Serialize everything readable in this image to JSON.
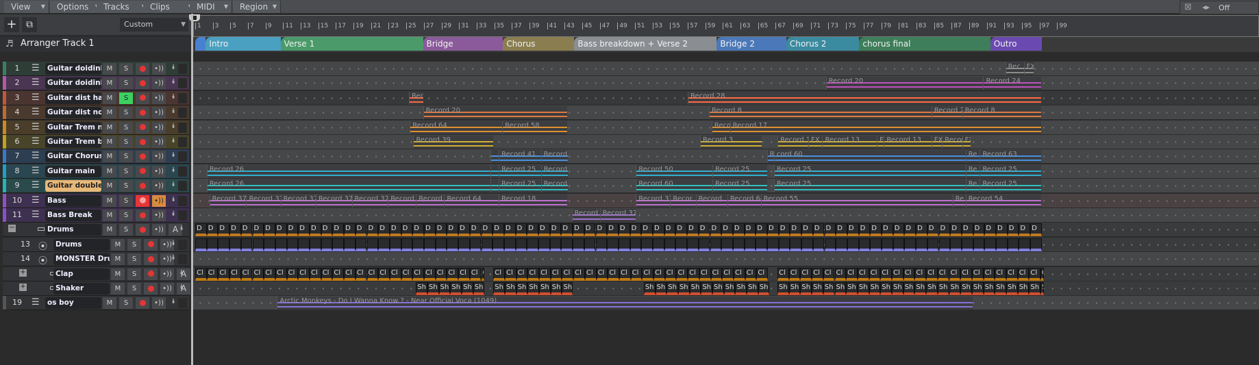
{
  "menubar": [
    {
      "label": "View"
    },
    {
      "label": "Options"
    },
    {
      "label": "Tracks"
    },
    {
      "label": "Clips"
    },
    {
      "label": "MIDI"
    },
    {
      "label": "Region FX"
    }
  ],
  "toolbar": {
    "add_icon": "plus-icon",
    "duplicate_icon": "duplicate-icon",
    "preset": "Custom"
  },
  "topright": {
    "snap_label": "Off",
    "icons": [
      "mixer-icon",
      "snap-icon"
    ]
  },
  "ruler": {
    "ticks": [
      "1",
      "3",
      "5",
      "7",
      "9",
      "11",
      "13",
      "15",
      "17",
      "19",
      "21",
      "23",
      "25",
      "27",
      "29",
      "31",
      "33",
      "35",
      "37",
      "39",
      "41",
      "43",
      "45",
      "47",
      "49",
      "51",
      "53",
      "55",
      "57",
      "59",
      "61",
      "63",
      "65",
      "67",
      "69",
      "71",
      "73",
      "75",
      "77",
      "79",
      "81",
      "83",
      "85",
      "87",
      "89",
      "91",
      "93",
      "95",
      "97",
      "99"
    ]
  },
  "arranger": {
    "title": "Arranger Track 1",
    "sections": [
      {
        "name": "",
        "start": 1,
        "end": 2.2,
        "color": "#4a80d0"
      },
      {
        "name": "Intro",
        "start": 2.2,
        "end": 10.7,
        "color": "#4aa0c0"
      },
      {
        "name": "Verse 1",
        "start": 10.7,
        "end": 26.9,
        "color": "#4a9a6a"
      },
      {
        "name": "Bridge",
        "start": 26.9,
        "end": 36,
        "color": "#8a5a9a"
      },
      {
        "name": "Chorus",
        "start": 36,
        "end": 44.1,
        "color": "#8a7e50"
      },
      {
        "name": "Bass breakdown + Verse 2",
        "start": 44.1,
        "end": 60.3,
        "color": "#8a8e92"
      },
      {
        "name": "Bridge 2",
        "start": 60.3,
        "end": 68.2,
        "color": "#4a78b8"
      },
      {
        "name": "Chorus 2",
        "start": 68.2,
        "end": 76.5,
        "color": "#3a8aa0"
      },
      {
        "name": "chorus final",
        "start": 76.5,
        "end": 91.4,
        "color": "#3e7e5a"
      },
      {
        "name": "Outro",
        "start": 91.4,
        "end": 97.3,
        "color": "#6a4ab0"
      }
    ]
  },
  "tracks": [
    {
      "num": "1",
      "name": "Guitar doidinha",
      "strip": "#3a8060",
      "bg": "#2f3d37",
      "line": "#8a8a8a",
      "type": "audio",
      "clips": [
        {
          "label": "Rec..",
          "s": 93.1,
          "e": 95.2
        },
        {
          "label": "FX",
          "s": 95.2,
          "e": 96.3
        }
      ]
    },
    {
      "num": "2",
      "name": "Guitar doidinha",
      "strip": "#b05aa8",
      "bg": "#4a3552",
      "line": "#c050c0",
      "type": "audio",
      "clips": [
        {
          "label": "Record 20",
          "s": 72.7,
          "e": 90.6
        },
        {
          "label": "Record 24",
          "s": 90.6,
          "e": 97.2
        }
      ]
    },
    {
      "num": "3",
      "name": "Guitar dist harm",
      "strip": "#c0583a",
      "bg": "#4a3530",
      "line": "#ff6a40",
      "type": "audio",
      "solo": true,
      "clips": [
        {
          "label": "Rec",
          "s": 25.3,
          "e": 26.9
        },
        {
          "label": "Record 28",
          "s": 57,
          "e": 97.2
        }
      ]
    },
    {
      "num": "4",
      "name": "Guitar dist noise",
      "strip": "#c06a30",
      "bg": "#4a3a2e",
      "line": "#e07a40",
      "type": "audio",
      "clips": [
        {
          "label": "Record 20",
          "s": 26.9,
          "e": 43.3
        },
        {
          "label": "Record 8",
          "s": 59.4,
          "e": 84.7
        },
        {
          "label": "Record 2",
          "s": 84.7,
          "e": 88.2
        },
        {
          "label": "Record 8",
          "s": 88.2,
          "e": 97.2
        }
      ]
    },
    {
      "num": "5",
      "name": "Guitar Trem nois",
      "strip": "#c98a20",
      "bg": "#4a3e2a",
      "line": "#e09030",
      "type": "audio",
      "clips": [
        {
          "label": "Record 64",
          "s": 25.4,
          "e": 35.9
        },
        {
          "label": "Record 58",
          "s": 35.9,
          "e": 43.3
        },
        {
          "label": "Reco",
          "s": 59.7,
          "e": 61.8
        },
        {
          "label": "Record 17",
          "s": 61.8,
          "e": 97.2
        }
      ]
    },
    {
      "num": "6",
      "name": "Guitar Trem bckp",
      "strip": "#c0a020",
      "bg": "#48442a",
      "line": "#d0b030",
      "type": "audio",
      "clips": [
        {
          "label": "Record 39",
          "s": 25.8,
          "e": 34.9
        },
        {
          "label": "Record 3",
          "s": 58.4,
          "e": 65.4
        },
        {
          "label": "Record 1",
          "s": 67.2,
          "e": 70.7
        },
        {
          "label": "FX",
          "s": 70.7,
          "e": 72.3
        },
        {
          "label": "Record 13",
          "s": 72.3,
          "e": 78.5
        },
        {
          "label": "FX",
          "s": 78.5,
          "e": 79.3
        },
        {
          "label": "Record 13",
          "s": 79.3,
          "e": 84.7
        },
        {
          "label": "FX",
          "s": 84.7,
          "e": 85.9
        },
        {
          "label": "Record",
          "s": 85.9,
          "e": 88.2
        },
        {
          "label": "FX",
          "s": 88.2,
          "e": 89.2
        }
      ]
    },
    {
      "num": "7",
      "name": "Guitar Chorus",
      "strip": "#3a78c8",
      "bg": "#2e3e52",
      "line": "#4a90e0",
      "type": "audio",
      "clips": [
        {
          "label": "",
          "s": 34.6,
          "e": 35.5
        },
        {
          "label": "Record 41",
          "s": 35.5,
          "e": 40.3
        },
        {
          "label": "Record",
          "s": 40.3,
          "e": 43.4
        },
        {
          "label": "R",
          "s": 66,
          "e": 66.8
        },
        {
          "label": "cord 60",
          "s": 66.8,
          "e": 88.6
        },
        {
          "label": "Re",
          "s": 88.6,
          "e": 90.2
        },
        {
          "label": "Record 63",
          "s": 90.2,
          "e": 97.2
        }
      ]
    },
    {
      "num": "8",
      "name": "Guitar main",
      "strip": "#20a0c0",
      "bg": "#2a4650",
      "line": "#30b0d0",
      "type": "audio",
      "clips": [
        {
          "label": "Record 26",
          "s": 2.3,
          "e": 34.6
        },
        {
          "label": "",
          "s": 34.6,
          "e": 35.5
        },
        {
          "label": "Record 25",
          "s": 35.5,
          "e": 40.3
        },
        {
          "label": "Record",
          "s": 40.3,
          "e": 43.4
        },
        {
          "label": "Record 50",
          "s": 51.1,
          "e": 59.8
        },
        {
          "label": "Record 25",
          "s": 59.8,
          "e": 66
        },
        {
          "label": "Record 25",
          "s": 66.8,
          "e": 88.6
        },
        {
          "label": "Re",
          "s": 88.6,
          "e": 90.2
        },
        {
          "label": "Record 25",
          "s": 90.2,
          "e": 97.2
        }
      ]
    },
    {
      "num": "9",
      "name": "Guitar doubletra",
      "strip": "#20b8b0",
      "bg": "#2a4a4c",
      "line": "#30c0c0",
      "type": "audio",
      "highlight": true,
      "clips": [
        {
          "label": "Record 26",
          "s": 2.3,
          "e": 34.6
        },
        {
          "label": "",
          "s": 34.6,
          "e": 35.5
        },
        {
          "label": "Record 25",
          "s": 35.5,
          "e": 40.3
        },
        {
          "label": "Record",
          "s": 40.3,
          "e": 43.4
        },
        {
          "label": "Record 60",
          "s": 51.1,
          "e": 59.8
        },
        {
          "label": "Record 25",
          "s": 59.8,
          "e": 66
        },
        {
          "label": "Record 25",
          "s": 66.8,
          "e": 88.6
        },
        {
          "label": "Re",
          "s": 88.6,
          "e": 90.2
        },
        {
          "label": "Record 25",
          "s": 90.2,
          "e": 97.2
        }
      ]
    },
    {
      "num": "10",
      "name": "Bass",
      "strip": "#9050c0",
      "bg": "#3e3050",
      "line": "#c070d0",
      "type": "audio",
      "armed": true,
      "clips": [
        {
          "label": "Record 37",
          "s": 2.6,
          "e": 6.8
        },
        {
          "label": "Record 37",
          "s": 6.8,
          "e": 10.7
        },
        {
          "label": "Record 37",
          "s": 10.7,
          "e": 14.7
        },
        {
          "label": "Record 37",
          "s": 14.7,
          "e": 18.8
        },
        {
          "label": "Record 37",
          "s": 18.8,
          "e": 22.9
        },
        {
          "label": "Record",
          "s": 22.9,
          "e": 26.1
        },
        {
          "label": "Record 6",
          "s": 26.1,
          "e": 29.3
        },
        {
          "label": "Record 64",
          "s": 29.3,
          "e": 35.5
        },
        {
          "label": "Record 18",
          "s": 35.5,
          "e": 43.3
        },
        {
          "label": "Record 37",
          "s": 51.1,
          "e": 55
        },
        {
          "label": "Recor",
          "s": 55,
          "e": 57.9
        },
        {
          "label": "Record",
          "s": 57.9,
          "e": 61.5
        },
        {
          "label": "Record 64",
          "s": 61.5,
          "e": 65.3
        },
        {
          "label": "Record 55",
          "s": 65.3,
          "e": 87.1
        },
        {
          "label": "Re",
          "s": 87.1,
          "e": 88.6
        },
        {
          "label": "Record 54",
          "s": 88.6,
          "e": 97.2
        }
      ]
    },
    {
      "num": "11",
      "name": "Bass Break",
      "strip": "#8a50c8",
      "bg": "#3e3050",
      "line": "#a070d0",
      "type": "audio",
      "clips": [
        {
          "label": "Record",
          "s": 43.8,
          "e": 47
        },
        {
          "label": "Record 37",
          "s": 47,
          "e": 51.1
        }
      ]
    },
    {
      "num": "",
      "name": "Drums",
      "type": "folder",
      "expanded": true,
      "auto": "A",
      "pattern": {
        "label": "D",
        "segments": [
          [
            1,
            97.5
          ]
        ],
        "color": "#c07a20"
      }
    },
    {
      "num": "13",
      "name": "Drums",
      "type": "instrument",
      "indent": true,
      "pattern": {
        "label": "",
        "segments": [
          [
            1,
            97.5
          ]
        ],
        "color": "#8080e0"
      }
    },
    {
      "num": "14",
      "name": "MONSTER Drum",
      "type": "instrument",
      "indent": true,
      "clips": []
    },
    {
      "num": "",
      "name": "Clap",
      "type": "folder",
      "indent": true,
      "auto": "A",
      "pattern": {
        "label": "Cl",
        "segments": [
          [
            1,
            33.9
          ],
          [
            34.9,
            66.3
          ],
          [
            67.2,
            97.5
          ]
        ],
        "color": "#c07a10"
      }
    },
    {
      "num": "",
      "name": "Shaker",
      "type": "folder",
      "indent": true,
      "auto": "A",
      "pattern": {
        "label": "Sh",
        "segments": [
          [
            26.1,
            33.9
          ],
          [
            34.9,
            43.9
          ],
          [
            52,
            66.3
          ],
          [
            67.2,
            97.5
          ]
        ],
        "color": "#d05030"
      }
    },
    {
      "num": "19",
      "name": "os boy",
      "strip": "#555",
      "bg": "#333436",
      "line": "#8a70d8",
      "type": "audio",
      "clips": [
        {
          "label": "Arctic Monkeys - Do I Wanna Know ? - Near Official Voca (1049)",
          "s": 10.3,
          "e": 89.4
        }
      ]
    }
  ],
  "button_labels": {
    "mute": "M",
    "solo": "S"
  }
}
